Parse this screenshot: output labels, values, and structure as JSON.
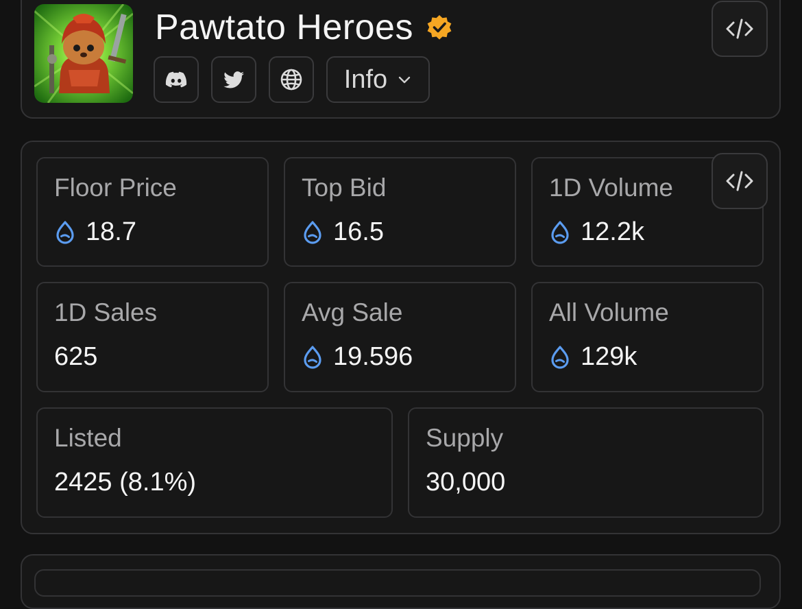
{
  "collection": {
    "name": "Pawtato Heroes",
    "verified": true,
    "avatar_alt": "Pawtato hero character in red armor holding a sword"
  },
  "header": {
    "social_links": [
      {
        "icon": "discord-icon"
      },
      {
        "icon": "twitter-icon"
      },
      {
        "icon": "globe-icon"
      }
    ],
    "info_label": "Info"
  },
  "stats": {
    "floor_price": {
      "label": "Floor Price",
      "value": "18.7",
      "currency_icon": "sui-drop-icon"
    },
    "top_bid": {
      "label": "Top Bid",
      "value": "16.5",
      "currency_icon": "sui-drop-icon"
    },
    "volume_1d": {
      "label": "1D Volume",
      "value": "12.2k",
      "currency_icon": "sui-drop-icon"
    },
    "sales_1d": {
      "label": "1D Sales",
      "value": "625"
    },
    "avg_sale": {
      "label": "Avg Sale",
      "value": "19.596",
      "currency_icon": "sui-drop-icon"
    },
    "all_volume": {
      "label": "All Volume",
      "value": "129k",
      "currency_icon": "sui-drop-icon"
    },
    "listed": {
      "label": "Listed",
      "value": "2425 (8.1%)"
    },
    "supply": {
      "label": "Supply",
      "value": "30,000"
    }
  },
  "colors": {
    "background": "#121212",
    "card_border": "#333335",
    "label_text": "#a8a8aa",
    "value_text": "#f5f5f5",
    "verified_badge": "#f5a623",
    "sui_icon": "#5b9cf0"
  }
}
